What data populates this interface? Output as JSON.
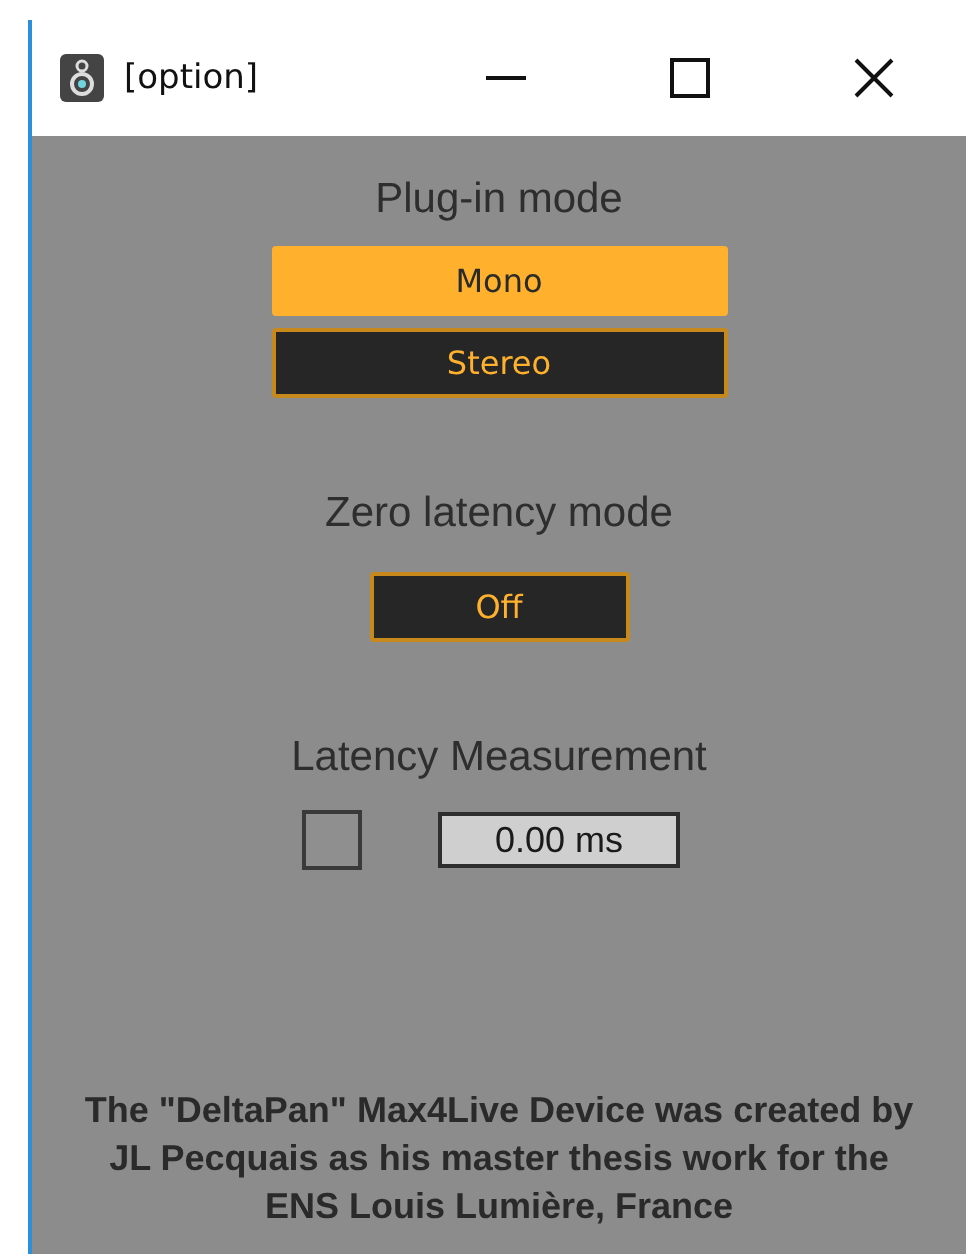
{
  "window": {
    "title": "[option]"
  },
  "plugin_mode": {
    "label": "Plug-in mode",
    "options": [
      {
        "label": "Mono",
        "selected": true
      },
      {
        "label": "Stereo",
        "selected": false
      }
    ]
  },
  "zero_latency": {
    "label": "Zero latency mode",
    "value": "Off",
    "on": false
  },
  "latency_measurement": {
    "label": "Latency Measurement",
    "checked": false,
    "value": "0.00 ms"
  },
  "credits": "The \"DeltaPan\" Max4Live Device was created by JL Pecquais as his master thesis work for the ENS Louis Lumière, France"
}
